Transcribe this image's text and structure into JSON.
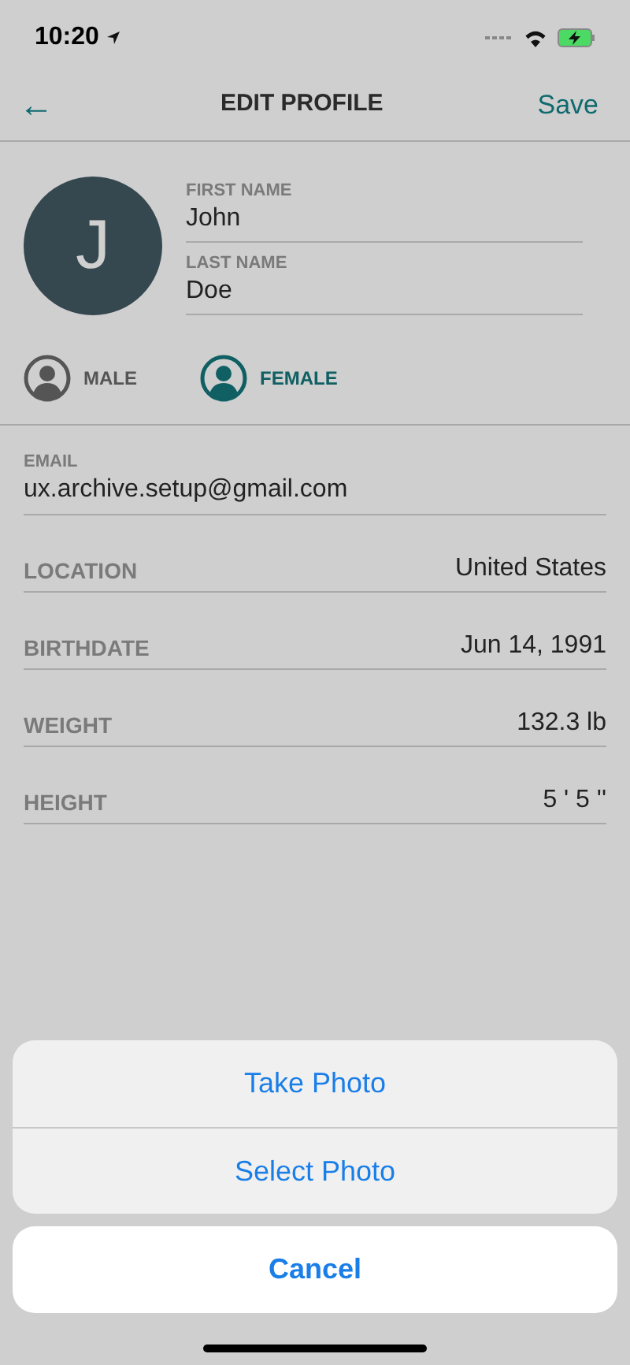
{
  "status_bar": {
    "time": "10:20"
  },
  "nav": {
    "back": "←",
    "title": "EDIT PROFILE",
    "action": "Save"
  },
  "avatar": {
    "initial": "J"
  },
  "name_fields": [
    {
      "label": "FIRST NAME",
      "value": "John"
    },
    {
      "label": "LAST NAME",
      "value": "Doe"
    }
  ],
  "gender": [
    {
      "label": "MALE",
      "selected": false
    },
    {
      "label": "FEMALE",
      "selected": true
    }
  ],
  "email": {
    "label": "EMAIL",
    "value": "ux.archive.setup@gmail.com"
  },
  "rows": [
    {
      "label": "LOCATION",
      "value": "United States"
    },
    {
      "label": "BIRTHDATE",
      "value": "Jun 14, 1991"
    },
    {
      "label": "WEIGHT",
      "value": "132.3 lb"
    },
    {
      "label": "HEIGHT",
      "value": "5 ' 5 ''"
    }
  ],
  "action_sheet": {
    "options": [
      "Take Photo",
      "Select Photo"
    ],
    "cancel": "Cancel"
  }
}
